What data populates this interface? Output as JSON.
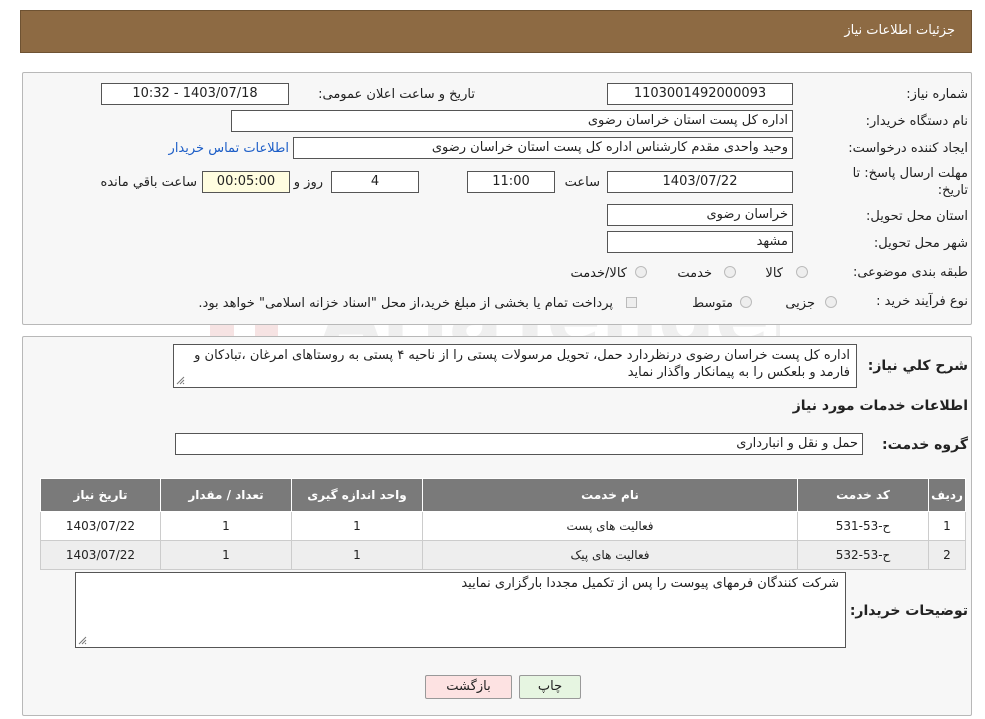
{
  "header": {
    "title": "جزئیات اطلاعات نیاز"
  },
  "form": {
    "need_number_label": "شماره نیاز:",
    "need_number": "1103001492000093",
    "announce_label": "تاریخ و ساعت اعلان عمومی:",
    "announce_value": "1403/07/18 - 10:32",
    "buyer_org_label": "نام دستگاه خریدار:",
    "buyer_org": "اداره کل پست استان خراسان رضوی",
    "requester_label": "ایجاد کننده درخواست:",
    "requester": "وحید واحدی مقدم کارشناس اداره کل پست استان خراسان رضوی",
    "contact_link": "اطلاعات تماس خریدار",
    "deadline_label_1": "مهلت ارسال پاسخ: تا",
    "deadline_label_2": "تاریخ:",
    "deadline_date": "1403/07/22",
    "time_label": "ساعت",
    "deadline_time": "11:00",
    "days_value": "4",
    "days_label": "روز و",
    "remaining_time": "00:05:00",
    "remaining_label": "ساعت باقي مانده",
    "province_label": "استان محل تحویل:",
    "province": "خراسان رضوی",
    "city_label": "شهر محل تحویل:",
    "city": "مشهد",
    "category_label": "طبقه بندی موضوعی:",
    "category_options": [
      "کالا",
      "خدمت",
      "کالا/خدمت"
    ],
    "category_selected": "خدمت",
    "process_label": "نوع فرآیند خرید :",
    "process_options": [
      "جزیی",
      "متوسط"
    ],
    "payment_note": "پرداخت تمام یا بخشی از مبلغ خرید،از محل \"اسناد خزانه اسلامی\" خواهد بود."
  },
  "description": {
    "label": "شرح کلي نياز:",
    "text": "اداره کل پست خراسان رضوی درنظردارد حمل، تحویل مرسولات پستی را از ناحیه ۴ پستی به روستاهای امرغان ،تبادکان و فارمد و بلعکس را به پیمانکار واگذار نماید"
  },
  "services": {
    "title": "اطلاعات خدمات مورد نياز",
    "group_label": "گروه خدمت:",
    "group_value": "حمل و نقل و انبارداری",
    "columns": [
      "ردیف",
      "کد خدمت",
      "نام خدمت",
      "واحد اندازه گیری",
      "تعداد / مقدار",
      "تاریخ نیاز"
    ],
    "rows": [
      [
        "1",
        "ح-53-531",
        "فعالیت های پست",
        "1",
        "1",
        "1403/07/22"
      ],
      [
        "2",
        "ح-53-532",
        "فعالیت های پیک",
        "1",
        "1",
        "1403/07/22"
      ]
    ]
  },
  "buyer_notes": {
    "label": "توضیحات خریدار:",
    "text": "شرکت کنندگان فرمهای پیوست را پس از تکمیل مجددا بارگزاری نمایید"
  },
  "buttons": {
    "print": "چاپ",
    "back": "بازگشت"
  },
  "watermark": {
    "text": "AriaTender.neT"
  },
  "colors": {
    "header_bg": "#8d6a43",
    "table_header_bg": "#7a7a7a",
    "link": "#1d5ec7",
    "back_button_bg": "#fde2e2",
    "print_button_bg": "#e6f5e1"
  }
}
